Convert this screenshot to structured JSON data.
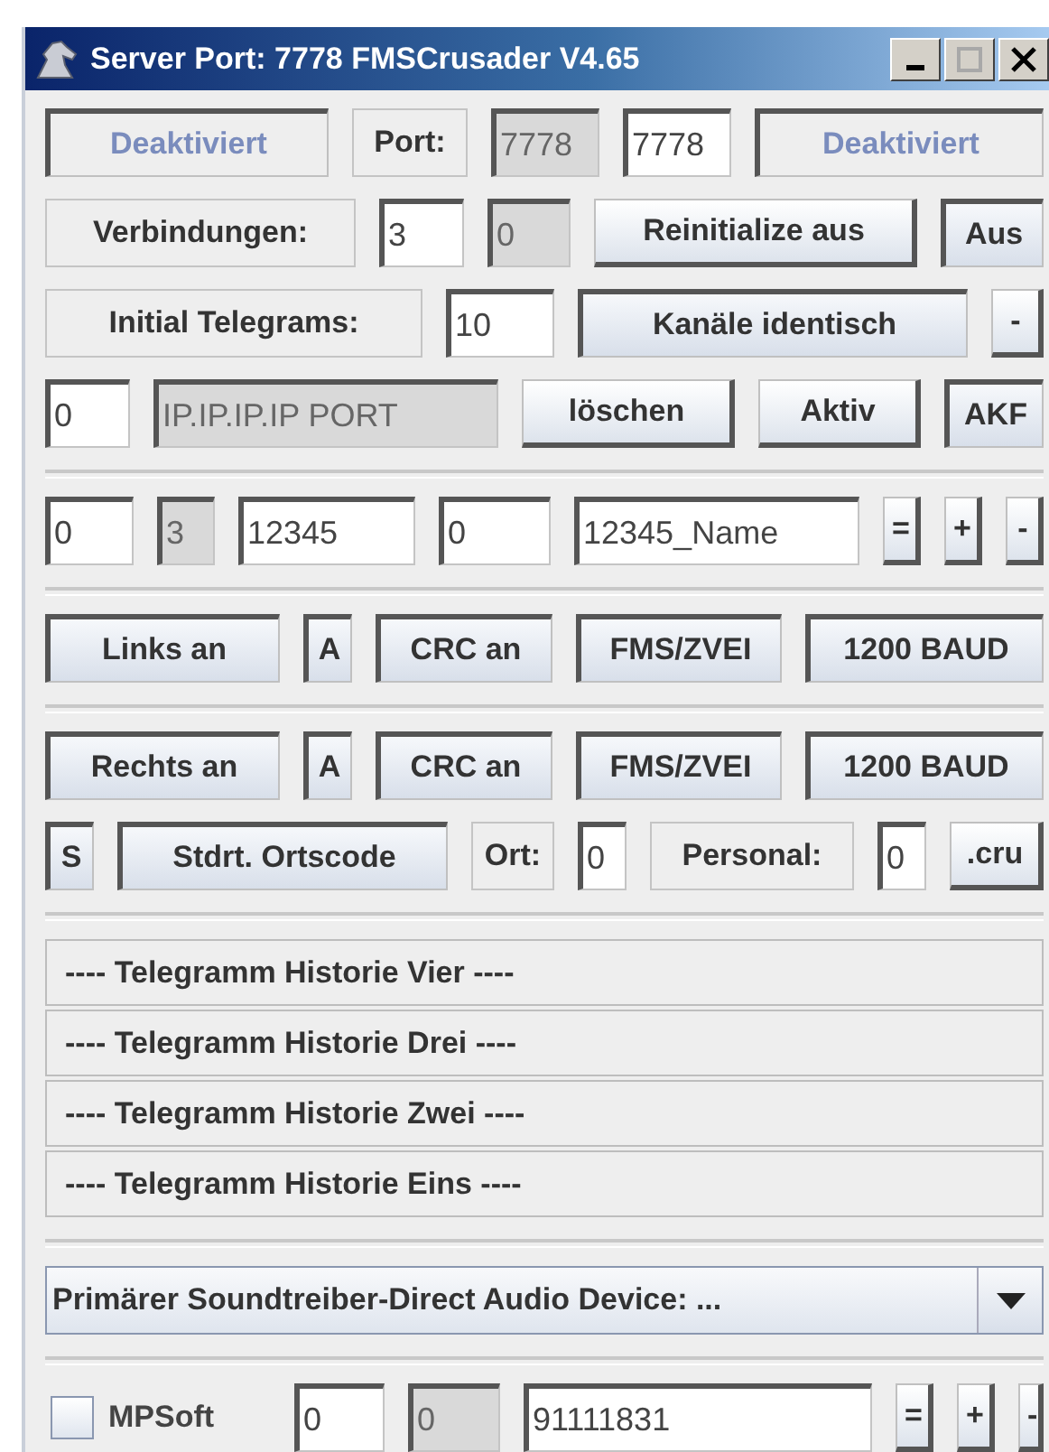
{
  "window": {
    "title": "Server Port: 7778 FMSCrusader V4.65"
  },
  "sections": [
    {
      "rows": [
        {
          "items": [
            {
              "kind": "button",
              "text": "Deaktiviert",
              "pressed": true,
              "disabled": true
            },
            {
              "kind": "label",
              "text": "Port:"
            },
            {
              "kind": "field",
              "text": "7778",
              "disabled": true
            },
            {
              "kind": "field",
              "text": "7778",
              "disabled": false
            },
            {
              "kind": "button",
              "text": "Deaktiviert",
              "pressed": true,
              "disabled": true
            }
          ]
        },
        {
          "items": [
            {
              "kind": "label",
              "text": "Verbindungen:"
            },
            {
              "kind": "field",
              "text": "3",
              "disabled": false
            },
            {
              "kind": "field",
              "text": "0",
              "disabled": true
            },
            {
              "kind": "button",
              "text": "Reinitialize aus",
              "pressed": false,
              "disabled": false
            },
            {
              "kind": "button",
              "text": "Aus",
              "pressed": true,
              "disabled": false
            }
          ]
        },
        {
          "items": [
            {
              "kind": "label",
              "text": "Initial Telegrams:"
            },
            {
              "kind": "field",
              "text": "10",
              "disabled": false
            },
            {
              "kind": "button",
              "text": "Kanäle identisch",
              "pressed": true,
              "disabled": false
            },
            {
              "kind": "button",
              "text": "-",
              "pressed": false,
              "disabled": false
            }
          ]
        },
        {
          "items": [
            {
              "kind": "field",
              "text": "0",
              "disabled": false
            },
            {
              "kind": "field",
              "text": "IP.IP.IP.IP PORT",
              "disabled": true
            },
            {
              "kind": "button",
              "text": "löschen",
              "pressed": false,
              "disabled": false
            },
            {
              "kind": "button",
              "text": "Aktiv",
              "pressed": false,
              "disabled": false
            },
            {
              "kind": "button",
              "text": "AKF",
              "pressed": true,
              "disabled": false
            }
          ]
        }
      ]
    },
    {
      "rows": [
        {
          "items": [
            {
              "kind": "field",
              "text": "0",
              "disabled": false
            },
            {
              "kind": "field",
              "text": "3",
              "disabled": true
            },
            {
              "kind": "field",
              "text": "12345",
              "disabled": false
            },
            {
              "kind": "field",
              "text": "0",
              "disabled": false
            },
            {
              "kind": "field",
              "text": "12345_Name",
              "disabled": false
            },
            {
              "kind": "button",
              "text": "=",
              "pressed": false,
              "disabled": false
            },
            {
              "kind": "button",
              "text": "+",
              "pressed": false,
              "disabled": false
            },
            {
              "kind": "button",
              "text": "-",
              "pressed": false,
              "disabled": false
            }
          ]
        }
      ]
    },
    {
      "rows": [
        {
          "items": [
            {
              "kind": "button",
              "text": "Links an",
              "pressed": true,
              "disabled": false
            },
            {
              "kind": "button",
              "text": "A",
              "pressed": true,
              "disabled": false
            },
            {
              "kind": "button",
              "text": "CRC an",
              "pressed": true,
              "disabled": false
            },
            {
              "kind": "button",
              "text": "FMS/ZVEI",
              "pressed": true,
              "disabled": false
            },
            {
              "kind": "button",
              "text": "1200 BAUD",
              "pressed": true,
              "disabled": false
            }
          ]
        }
      ]
    },
    {
      "rows": [
        {
          "items": [
            {
              "kind": "button",
              "text": "Rechts an",
              "pressed": true,
              "disabled": false
            },
            {
              "kind": "button",
              "text": "A",
              "pressed": true,
              "disabled": false
            },
            {
              "kind": "button",
              "text": "CRC an",
              "pressed": true,
              "disabled": false
            },
            {
              "kind": "button",
              "text": "FMS/ZVEI",
              "pressed": true,
              "disabled": false
            },
            {
              "kind": "button",
              "text": "1200 BAUD",
              "pressed": true,
              "disabled": false
            }
          ]
        },
        {
          "items": [
            {
              "kind": "button",
              "text": "S",
              "pressed": true,
              "disabled": false
            },
            {
              "kind": "button",
              "text": "Stdrt. Ortscode",
              "pressed": true,
              "disabled": false
            },
            {
              "kind": "label",
              "text": "Ort:"
            },
            {
              "kind": "field",
              "text": "0",
              "disabled": false
            },
            {
              "kind": "label",
              "text": "Personal:"
            },
            {
              "kind": "field",
              "text": "0",
              "disabled": false
            },
            {
              "kind": "button",
              "text": ".cru",
              "pressed": false,
              "disabled": false
            }
          ]
        }
      ]
    },
    {
      "rows": [
        {
          "items": [
            {
              "kind": "history",
              "text": "---- Telegramm Historie Vier ----"
            }
          ]
        },
        {
          "items": [
            {
              "kind": "history",
              "text": "---- Telegramm Historie Drei ----"
            }
          ]
        },
        {
          "items": [
            {
              "kind": "history",
              "text": "---- Telegramm Historie Zwei ----"
            }
          ]
        },
        {
          "items": [
            {
              "kind": "history",
              "text": "---- Telegramm Historie Eins ----"
            }
          ]
        }
      ]
    },
    {
      "rows": [
        {
          "items": [
            {
              "kind": "combo",
              "text": "Primärer Soundtreiber-Direct Audio Device: ..."
            }
          ]
        }
      ]
    },
    {
      "rows": [
        {
          "items": [
            {
              "kind": "checkbox",
              "text": "MPSoft",
              "checked": false
            },
            {
              "kind": "field",
              "text": "0",
              "disabled": false
            },
            {
              "kind": "field",
              "text": "0",
              "disabled": true
            },
            {
              "kind": "field",
              "text": "91111831",
              "disabled": false
            },
            {
              "kind": "button",
              "text": "=",
              "pressed": false,
              "disabled": false
            },
            {
              "kind": "button",
              "text": "+",
              "pressed": false,
              "disabled": false
            },
            {
              "kind": "button",
              "text": "-",
              "pressed": false,
              "disabled": false
            }
          ]
        }
      ]
    }
  ]
}
